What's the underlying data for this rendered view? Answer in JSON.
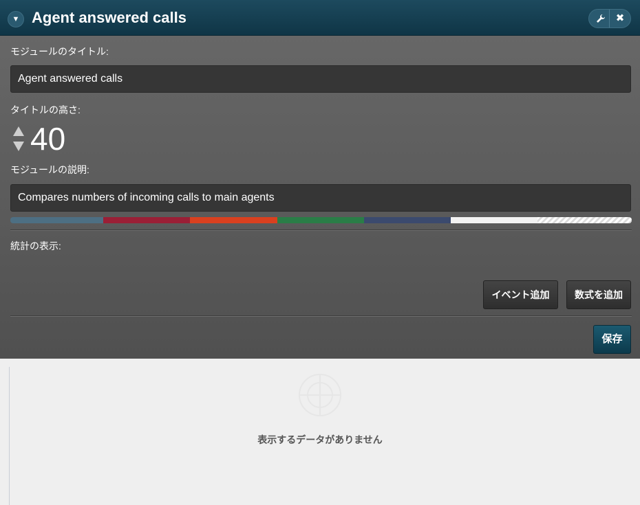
{
  "header": {
    "title": "Agent answered calls",
    "collapse_icon": "▼",
    "wrench_icon": "🔧",
    "close_icon": "✖"
  },
  "form": {
    "module_title_label": "モジュールのタイトル:",
    "module_title_value": "Agent answered calls",
    "title_height_label": "タイトルの高さ:",
    "title_height_value": "40",
    "module_description_label": "モジュールの説明:",
    "module_description_value": "Compares numbers of incoming calls to main agents",
    "color_palette": [
      "#4d6f83",
      "#9a1f36",
      "#d9401f",
      "#2a7d47",
      "#3b4a6e",
      "#f2f2f2",
      "#ffffff"
    ],
    "stats_label": "統計の表示:",
    "add_event_button": "イベント追加",
    "add_formula_button": "数式を追加",
    "save_button": "保存"
  },
  "chart": {
    "no_data_text": "表示するデータがありません"
  }
}
